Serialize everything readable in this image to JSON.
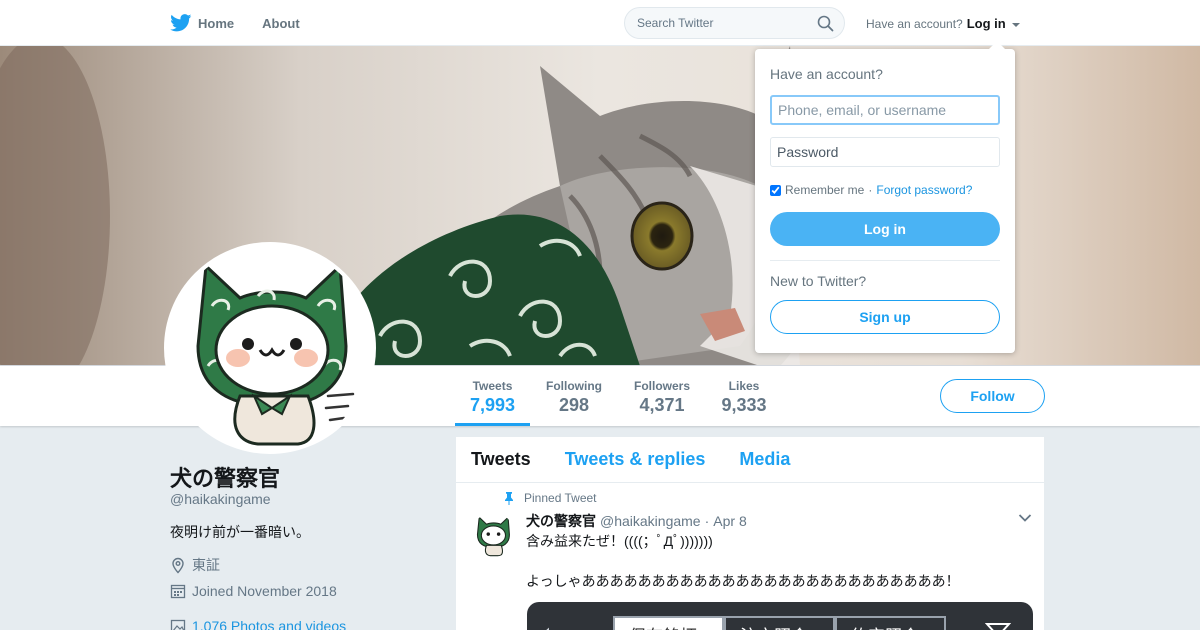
{
  "nav": {
    "home_label": "Home",
    "about_label": "About",
    "search_placeholder": "Search Twitter",
    "have_account": "Have an account?",
    "login_label": "Log in"
  },
  "colors": {
    "accent": "#1da1f2",
    "button_blue": "#4ab3f4",
    "background": "#e6ecf0"
  },
  "profile": {
    "name": "犬の警察官",
    "handle": "@haikakingame",
    "bio": "夜明け前が一番暗い。",
    "location": "東証",
    "joined": "Joined November 2018",
    "photos_link": "1,076 Photos and videos"
  },
  "stats": [
    {
      "label": "Tweets",
      "value": "7,993",
      "active": true
    },
    {
      "label": "Following",
      "value": "298",
      "active": false
    },
    {
      "label": "Followers",
      "value": "4,371",
      "active": false
    },
    {
      "label": "Likes",
      "value": "9,333",
      "active": false
    }
  ],
  "follow_label": "Follow",
  "timeline": {
    "tabs": [
      "Tweets",
      "Tweets & replies",
      "Media"
    ],
    "pinned": {
      "pin_label": "Pinned Tweet",
      "author": "犬の警察官",
      "handle": "@haikakingame",
      "date": "Apr 8",
      "line1": "含み益来たぜ！((((；ﾟДﾟ)))))))",
      "line2": "よっしゃああああああああああああああああああああああああああ！",
      "media_tabs": [
        "保有銘柄",
        "注文照会",
        "約定照会"
      ]
    }
  },
  "login_dropdown": {
    "title": "Have an account?",
    "username_placeholder": "Phone, email, or username",
    "password_placeholder": "Password",
    "remember_label": "Remember me",
    "forgot_label": "Forgot password?",
    "remember_checked": true,
    "login_button": "Log in",
    "new_to": "New to Twitter?",
    "signup_button": "Sign up"
  }
}
